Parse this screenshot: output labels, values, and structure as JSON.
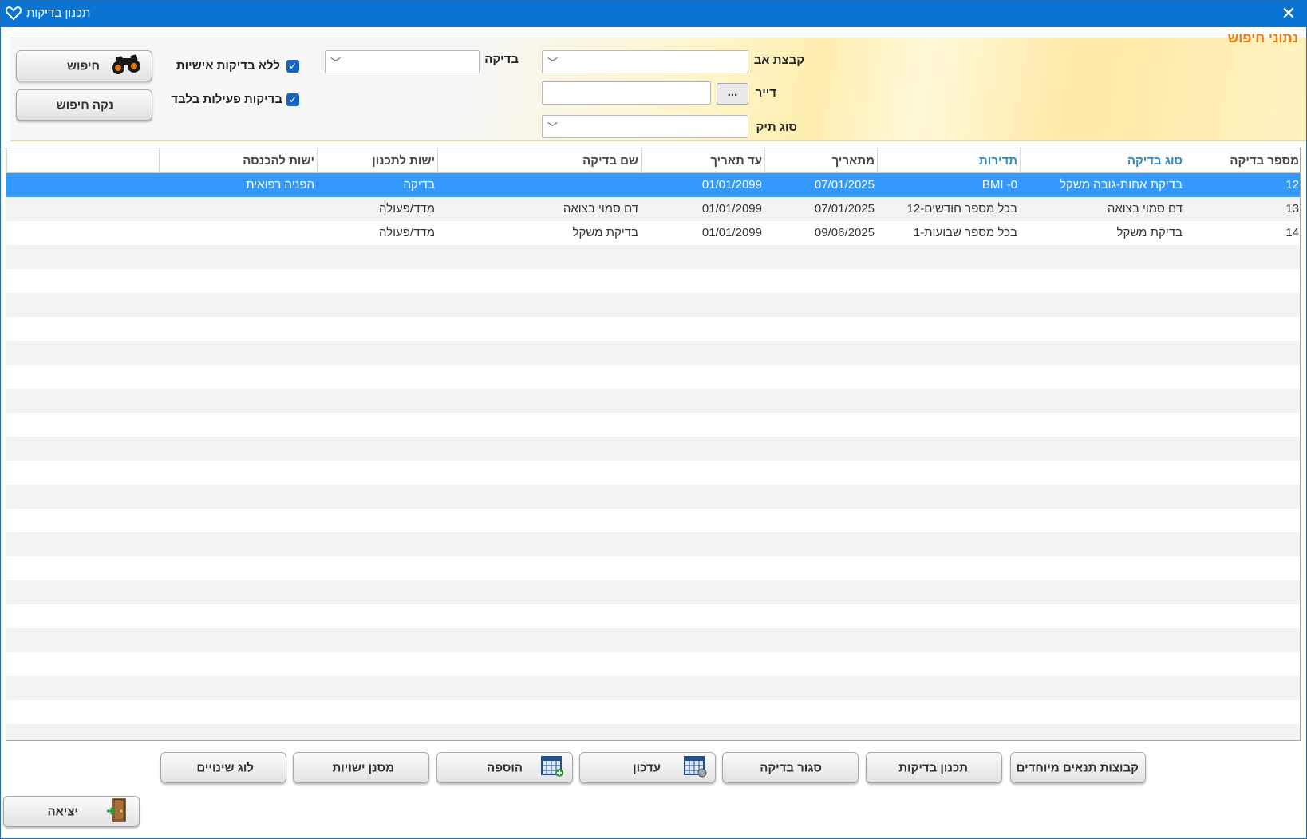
{
  "window": {
    "title": "תכנון בדיקות"
  },
  "search_panel": {
    "title": "נתוני חיפוש",
    "labels": {
      "parent_group": "קבצת אב",
      "resident": "דייר",
      "file_type": "סוג תיק",
      "test": "בדיקה"
    },
    "resident_button": "...",
    "checkboxes": [
      {
        "label": "ללא בדיקות אישיות",
        "checked": true
      },
      {
        "label": "בדיקות פעילות בלבד",
        "checked": true
      }
    ],
    "search_button": "חיפוש",
    "clear_button": "נקה חיפוש"
  },
  "grid": {
    "columns": [
      "מספר בדיקה",
      "סוג בדיקה",
      "תדירות",
      "מתאריך",
      "עד תאריך",
      "שם בדיקה",
      "ישות לתכנון",
      "ישות להכנסה"
    ],
    "rows": [
      {
        "num": "12",
        "type": "בדיקת אחות-גובה משקל",
        "freq": "BMI -0",
        "from": "07/01/2025",
        "to": "01/01/2099",
        "name": "",
        "plan_entity": "בדיקה",
        "entry_entity": "הפניה רפואית",
        "selected": true
      },
      {
        "num": "13",
        "type": "דם סמוי בצואה",
        "freq": "בכל מספר חודשים-12",
        "from": "07/01/2025",
        "to": "01/01/2099",
        "name": "דם סמוי בצואה",
        "plan_entity": "מדד/פעולה",
        "entry_entity": "",
        "selected": false
      },
      {
        "num": "14",
        "type": "בדיקת משקל",
        "freq": "בכל מספר שבועות-1",
        "from": "09/06/2025",
        "to": "01/01/2099",
        "name": "בדיקת משקל",
        "plan_entity": "מדד/פעולה",
        "entry_entity": "",
        "selected": false
      }
    ]
  },
  "footer": {
    "buttons": {
      "special_groups": "קבוצות תנאים מיוחדים",
      "test_planning": "תכנון בדיקות",
      "test_type": "סגור בדיקה",
      "update": "עדכון",
      "add": "הוספה",
      "entity_filter": "מסנן ישויות",
      "change_log": "לוג שינויים",
      "exit": "יציאה"
    }
  },
  "colors": {
    "titlebar": "#0a74d4",
    "selected_row": "#3399ff",
    "panel_title": "#f07a10",
    "header_blue": "#2a8ad0"
  }
}
